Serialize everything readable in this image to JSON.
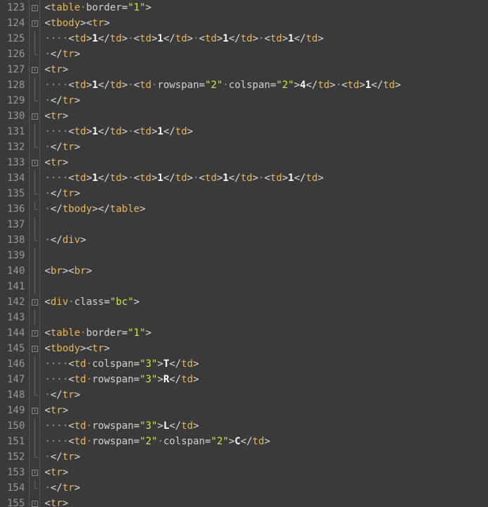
{
  "lines": [
    {
      "num": "123",
      "fold": "marker",
      "tokens": [
        {
          "c": "p",
          "t": "<"
        },
        {
          "c": "t",
          "t": "table"
        },
        {
          "c": "w",
          "t": "·"
        },
        {
          "c": "a",
          "t": "border"
        },
        {
          "c": "p",
          "t": "="
        },
        {
          "c": "v",
          "t": "\"1\""
        },
        {
          "c": "p",
          "t": ">"
        }
      ]
    },
    {
      "num": "124",
      "fold": "marker",
      "tokens": [
        {
          "c": "p",
          "t": "<"
        },
        {
          "c": "t",
          "t": "tbody"
        },
        {
          "c": "p",
          "t": ">"
        },
        {
          "c": "p",
          "t": "<"
        },
        {
          "c": "t",
          "t": "tr"
        },
        {
          "c": "p",
          "t": ">"
        }
      ]
    },
    {
      "num": "125",
      "fold": "vline",
      "tokens": [
        {
          "c": "w",
          "t": "····"
        },
        {
          "c": "p",
          "t": "<"
        },
        {
          "c": "t",
          "t": "td"
        },
        {
          "c": "p",
          "t": ">"
        },
        {
          "c": "x",
          "t": "1"
        },
        {
          "c": "p",
          "t": "</"
        },
        {
          "c": "t",
          "t": "td"
        },
        {
          "c": "p",
          "t": ">"
        },
        {
          "c": "w",
          "t": "·"
        },
        {
          "c": "p",
          "t": "<"
        },
        {
          "c": "t",
          "t": "td"
        },
        {
          "c": "p",
          "t": ">"
        },
        {
          "c": "x",
          "t": "1"
        },
        {
          "c": "p",
          "t": "</"
        },
        {
          "c": "t",
          "t": "td"
        },
        {
          "c": "p",
          "t": ">"
        },
        {
          "c": "w",
          "t": "·"
        },
        {
          "c": "p",
          "t": "<"
        },
        {
          "c": "t",
          "t": "td"
        },
        {
          "c": "p",
          "t": ">"
        },
        {
          "c": "x",
          "t": "1"
        },
        {
          "c": "p",
          "t": "</"
        },
        {
          "c": "t",
          "t": "td"
        },
        {
          "c": "p",
          "t": ">"
        },
        {
          "c": "w",
          "t": "·"
        },
        {
          "c": "p",
          "t": "<"
        },
        {
          "c": "t",
          "t": "td"
        },
        {
          "c": "p",
          "t": ">"
        },
        {
          "c": "x",
          "t": "1"
        },
        {
          "c": "p",
          "t": "</"
        },
        {
          "c": "t",
          "t": "td"
        },
        {
          "c": "p",
          "t": ">"
        }
      ]
    },
    {
      "num": "126",
      "fold": "end",
      "tokens": [
        {
          "c": "w",
          "t": "·"
        },
        {
          "c": "p",
          "t": "</"
        },
        {
          "c": "t",
          "t": "tr"
        },
        {
          "c": "p",
          "t": ">"
        }
      ]
    },
    {
      "num": "127",
      "fold": "marker",
      "tokens": [
        {
          "c": "p",
          "t": "<"
        },
        {
          "c": "t",
          "t": "tr"
        },
        {
          "c": "p",
          "t": ">"
        }
      ]
    },
    {
      "num": "128",
      "fold": "vline",
      "tokens": [
        {
          "c": "w",
          "t": "····"
        },
        {
          "c": "p",
          "t": "<"
        },
        {
          "c": "t",
          "t": "td"
        },
        {
          "c": "p",
          "t": ">"
        },
        {
          "c": "x",
          "t": "1"
        },
        {
          "c": "p",
          "t": "</"
        },
        {
          "c": "t",
          "t": "td"
        },
        {
          "c": "p",
          "t": ">"
        },
        {
          "c": "w",
          "t": "·"
        },
        {
          "c": "p",
          "t": "<"
        },
        {
          "c": "t",
          "t": "td"
        },
        {
          "c": "w",
          "t": "·"
        },
        {
          "c": "a",
          "t": "rowspan"
        },
        {
          "c": "p",
          "t": "="
        },
        {
          "c": "v",
          "t": "\"2\""
        },
        {
          "c": "w",
          "t": "·"
        },
        {
          "c": "a",
          "t": "colspan"
        },
        {
          "c": "p",
          "t": "="
        },
        {
          "c": "v",
          "t": "\"2\""
        },
        {
          "c": "p",
          "t": ">"
        },
        {
          "c": "x",
          "t": "4"
        },
        {
          "c": "p",
          "t": "</"
        },
        {
          "c": "t",
          "t": "td"
        },
        {
          "c": "p",
          "t": ">"
        },
        {
          "c": "w",
          "t": "·"
        },
        {
          "c": "p",
          "t": "<"
        },
        {
          "c": "t",
          "t": "td"
        },
        {
          "c": "p",
          "t": ">"
        },
        {
          "c": "x",
          "t": "1"
        },
        {
          "c": "p",
          "t": "</"
        },
        {
          "c": "t",
          "t": "td"
        },
        {
          "c": "p",
          "t": ">"
        }
      ]
    },
    {
      "num": "129",
      "fold": "end",
      "tokens": [
        {
          "c": "w",
          "t": "·"
        },
        {
          "c": "p",
          "t": "</"
        },
        {
          "c": "t",
          "t": "tr"
        },
        {
          "c": "p",
          "t": ">"
        }
      ]
    },
    {
      "num": "130",
      "fold": "marker",
      "tokens": [
        {
          "c": "p",
          "t": "<"
        },
        {
          "c": "t",
          "t": "tr"
        },
        {
          "c": "p",
          "t": ">"
        }
      ]
    },
    {
      "num": "131",
      "fold": "vline",
      "tokens": [
        {
          "c": "w",
          "t": "····"
        },
        {
          "c": "p",
          "t": "<"
        },
        {
          "c": "t",
          "t": "td"
        },
        {
          "c": "p",
          "t": ">"
        },
        {
          "c": "x",
          "t": "1"
        },
        {
          "c": "p",
          "t": "</"
        },
        {
          "c": "t",
          "t": "td"
        },
        {
          "c": "p",
          "t": ">"
        },
        {
          "c": "w",
          "t": "·"
        },
        {
          "c": "p",
          "t": "<"
        },
        {
          "c": "t",
          "t": "td"
        },
        {
          "c": "p",
          "t": ">"
        },
        {
          "c": "x",
          "t": "1"
        },
        {
          "c": "p",
          "t": "</"
        },
        {
          "c": "t",
          "t": "td"
        },
        {
          "c": "p",
          "t": ">"
        }
      ]
    },
    {
      "num": "132",
      "fold": "end",
      "tokens": [
        {
          "c": "w",
          "t": "·"
        },
        {
          "c": "p",
          "t": "</"
        },
        {
          "c": "t",
          "t": "tr"
        },
        {
          "c": "p",
          "t": ">"
        }
      ]
    },
    {
      "num": "133",
      "fold": "marker",
      "tokens": [
        {
          "c": "p",
          "t": "<"
        },
        {
          "c": "t",
          "t": "tr"
        },
        {
          "c": "p",
          "t": ">"
        }
      ]
    },
    {
      "num": "134",
      "fold": "vline",
      "tokens": [
        {
          "c": "w",
          "t": "····"
        },
        {
          "c": "p",
          "t": "<"
        },
        {
          "c": "t",
          "t": "td"
        },
        {
          "c": "p",
          "t": ">"
        },
        {
          "c": "x",
          "t": "1"
        },
        {
          "c": "p",
          "t": "</"
        },
        {
          "c": "t",
          "t": "td"
        },
        {
          "c": "p",
          "t": ">"
        },
        {
          "c": "w",
          "t": "·"
        },
        {
          "c": "p",
          "t": "<"
        },
        {
          "c": "t",
          "t": "td"
        },
        {
          "c": "p",
          "t": ">"
        },
        {
          "c": "x",
          "t": "1"
        },
        {
          "c": "p",
          "t": "</"
        },
        {
          "c": "t",
          "t": "td"
        },
        {
          "c": "p",
          "t": ">"
        },
        {
          "c": "w",
          "t": "·"
        },
        {
          "c": "p",
          "t": "<"
        },
        {
          "c": "t",
          "t": "td"
        },
        {
          "c": "p",
          "t": ">"
        },
        {
          "c": "x",
          "t": "1"
        },
        {
          "c": "p",
          "t": "</"
        },
        {
          "c": "t",
          "t": "td"
        },
        {
          "c": "p",
          "t": ">"
        },
        {
          "c": "w",
          "t": "·"
        },
        {
          "c": "p",
          "t": "<"
        },
        {
          "c": "t",
          "t": "td"
        },
        {
          "c": "p",
          "t": ">"
        },
        {
          "c": "x",
          "t": "1"
        },
        {
          "c": "p",
          "t": "</"
        },
        {
          "c": "t",
          "t": "td"
        },
        {
          "c": "p",
          "t": ">"
        }
      ]
    },
    {
      "num": "135",
      "fold": "end",
      "tokens": [
        {
          "c": "w",
          "t": "·"
        },
        {
          "c": "p",
          "t": "</"
        },
        {
          "c": "t",
          "t": "tr"
        },
        {
          "c": "p",
          "t": ">"
        }
      ]
    },
    {
      "num": "136",
      "fold": "end",
      "tokens": [
        {
          "c": "w",
          "t": "·"
        },
        {
          "c": "p",
          "t": "</"
        },
        {
          "c": "t",
          "t": "tbody"
        },
        {
          "c": "p",
          "t": ">"
        },
        {
          "c": "p",
          "t": "</"
        },
        {
          "c": "t",
          "t": "table"
        },
        {
          "c": "p",
          "t": ">"
        }
      ]
    },
    {
      "num": "137",
      "fold": "vline",
      "tokens": []
    },
    {
      "num": "138",
      "fold": "end",
      "tokens": [
        {
          "c": "w",
          "t": "·"
        },
        {
          "c": "p",
          "t": "</"
        },
        {
          "c": "t",
          "t": "div"
        },
        {
          "c": "p",
          "t": ">"
        }
      ]
    },
    {
      "num": "139",
      "fold": "vline",
      "tokens": []
    },
    {
      "num": "140",
      "fold": "vline",
      "tokens": [
        {
          "c": "p",
          "t": "<"
        },
        {
          "c": "t",
          "t": "br"
        },
        {
          "c": "p",
          "t": ">"
        },
        {
          "c": "p",
          "t": "<"
        },
        {
          "c": "t",
          "t": "br"
        },
        {
          "c": "p",
          "t": ">"
        }
      ]
    },
    {
      "num": "141",
      "fold": "vline",
      "tokens": []
    },
    {
      "num": "142",
      "fold": "marker",
      "tokens": [
        {
          "c": "p",
          "t": "<"
        },
        {
          "c": "t",
          "t": "div"
        },
        {
          "c": "w",
          "t": "·"
        },
        {
          "c": "a",
          "t": "class"
        },
        {
          "c": "p",
          "t": "="
        },
        {
          "c": "v",
          "t": "\"bc\""
        },
        {
          "c": "p",
          "t": ">"
        }
      ]
    },
    {
      "num": "143",
      "fold": "vline",
      "tokens": []
    },
    {
      "num": "144",
      "fold": "marker",
      "tokens": [
        {
          "c": "p",
          "t": "<"
        },
        {
          "c": "t",
          "t": "table"
        },
        {
          "c": "w",
          "t": "·"
        },
        {
          "c": "a",
          "t": "border"
        },
        {
          "c": "p",
          "t": "="
        },
        {
          "c": "v",
          "t": "\"1\""
        },
        {
          "c": "p",
          "t": ">"
        }
      ]
    },
    {
      "num": "145",
      "fold": "marker",
      "tokens": [
        {
          "c": "p",
          "t": "<"
        },
        {
          "c": "t",
          "t": "tbody"
        },
        {
          "c": "p",
          "t": ">"
        },
        {
          "c": "p",
          "t": "<"
        },
        {
          "c": "t",
          "t": "tr"
        },
        {
          "c": "p",
          "t": ">"
        }
      ]
    },
    {
      "num": "146",
      "fold": "vline",
      "tokens": [
        {
          "c": "w",
          "t": "····"
        },
        {
          "c": "p",
          "t": "<"
        },
        {
          "c": "t",
          "t": "td"
        },
        {
          "c": "w",
          "t": "·"
        },
        {
          "c": "a",
          "t": "colspan"
        },
        {
          "c": "p",
          "t": "="
        },
        {
          "c": "v",
          "t": "\"3\""
        },
        {
          "c": "p",
          "t": ">"
        },
        {
          "c": "x",
          "t": "T"
        },
        {
          "c": "p",
          "t": "</"
        },
        {
          "c": "t",
          "t": "td"
        },
        {
          "c": "p",
          "t": ">"
        }
      ]
    },
    {
      "num": "147",
      "fold": "vline",
      "tokens": [
        {
          "c": "w",
          "t": "····"
        },
        {
          "c": "p",
          "t": "<"
        },
        {
          "c": "t",
          "t": "td"
        },
        {
          "c": "w",
          "t": "·"
        },
        {
          "c": "a",
          "t": "rowspan"
        },
        {
          "c": "p",
          "t": "="
        },
        {
          "c": "v",
          "t": "\"3\""
        },
        {
          "c": "p",
          "t": ">"
        },
        {
          "c": "x",
          "t": "R"
        },
        {
          "c": "p",
          "t": "</"
        },
        {
          "c": "t",
          "t": "td"
        },
        {
          "c": "p",
          "t": ">"
        }
      ]
    },
    {
      "num": "148",
      "fold": "end",
      "tokens": [
        {
          "c": "w",
          "t": "·"
        },
        {
          "c": "p",
          "t": "</"
        },
        {
          "c": "t",
          "t": "tr"
        },
        {
          "c": "p",
          "t": ">"
        }
      ]
    },
    {
      "num": "149",
      "fold": "marker",
      "tokens": [
        {
          "c": "p",
          "t": "<"
        },
        {
          "c": "t",
          "t": "tr"
        },
        {
          "c": "p",
          "t": ">"
        }
      ]
    },
    {
      "num": "150",
      "fold": "vline",
      "tokens": [
        {
          "c": "w",
          "t": "····"
        },
        {
          "c": "p",
          "t": "<"
        },
        {
          "c": "t",
          "t": "td"
        },
        {
          "c": "w",
          "t": "·"
        },
        {
          "c": "a",
          "t": "rowspan"
        },
        {
          "c": "p",
          "t": "="
        },
        {
          "c": "v",
          "t": "\"3\""
        },
        {
          "c": "p",
          "t": ">"
        },
        {
          "c": "x",
          "t": "L"
        },
        {
          "c": "p",
          "t": "</"
        },
        {
          "c": "t",
          "t": "td"
        },
        {
          "c": "p",
          "t": ">"
        }
      ]
    },
    {
      "num": "151",
      "fold": "vline",
      "tokens": [
        {
          "c": "w",
          "t": "····"
        },
        {
          "c": "p",
          "t": "<"
        },
        {
          "c": "t",
          "t": "td"
        },
        {
          "c": "w",
          "t": "·"
        },
        {
          "c": "a",
          "t": "rowspan"
        },
        {
          "c": "p",
          "t": "="
        },
        {
          "c": "v",
          "t": "\"2\""
        },
        {
          "c": "w",
          "t": "·"
        },
        {
          "c": "a",
          "t": "colspan"
        },
        {
          "c": "p",
          "t": "="
        },
        {
          "c": "v",
          "t": "\"2\""
        },
        {
          "c": "p",
          "t": ">"
        },
        {
          "c": "x",
          "t": "C"
        },
        {
          "c": "p",
          "t": "</"
        },
        {
          "c": "t",
          "t": "td"
        },
        {
          "c": "p",
          "t": ">"
        }
      ]
    },
    {
      "num": "152",
      "fold": "end",
      "tokens": [
        {
          "c": "w",
          "t": "·"
        },
        {
          "c": "p",
          "t": "</"
        },
        {
          "c": "t",
          "t": "tr"
        },
        {
          "c": "p",
          "t": ">"
        }
      ]
    },
    {
      "num": "153",
      "fold": "marker",
      "tokens": [
        {
          "c": "p",
          "t": "<"
        },
        {
          "c": "t",
          "t": "tr"
        },
        {
          "c": "p",
          "t": ">"
        }
      ]
    },
    {
      "num": "154",
      "fold": "end",
      "tokens": [
        {
          "c": "w",
          "t": "·"
        },
        {
          "c": "p",
          "t": "</"
        },
        {
          "c": "t",
          "t": "tr"
        },
        {
          "c": "p",
          "t": ">"
        }
      ]
    },
    {
      "num": "155",
      "fold": "marker",
      "tokens": [
        {
          "c": "p",
          "t": "<"
        },
        {
          "c": "t",
          "t": "tr"
        },
        {
          "c": "p",
          "t": ">"
        }
      ]
    }
  ]
}
